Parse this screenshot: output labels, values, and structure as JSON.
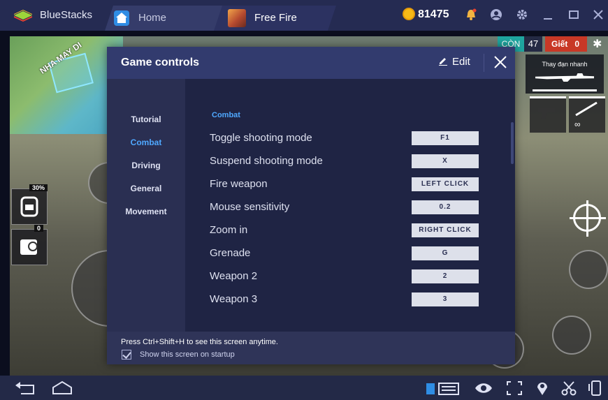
{
  "titlebar": {
    "app_name": "BlueStacks",
    "tabs": [
      {
        "label": "Home",
        "icon": "home-icon"
      },
      {
        "label": "Free Fire",
        "icon": "free-fire-app-icon"
      }
    ],
    "coins": "81475",
    "icons": [
      "notification-bell-icon",
      "account-icon",
      "settings-gear-icon",
      "minimize-icon",
      "maximize-icon",
      "close-icon"
    ]
  },
  "game_hud": {
    "map_label": "NHA MAY DI",
    "con_label": "CÒN",
    "alive_count": "47",
    "kill_label": "Giết",
    "kill_count": "0",
    "weapon_label": "Thay đạn nhanh",
    "backpack_percent": "30%",
    "item_count": "0",
    "ammo_symbol": "∞"
  },
  "dialog": {
    "title": "Game controls",
    "edit_label": "Edit",
    "nav": [
      "Tutorial",
      "Combat",
      "Driving",
      "General",
      "Movement"
    ],
    "active_nav": "Combat",
    "section_title": "Combat",
    "controls": [
      {
        "label": "Toggle shooting mode",
        "key": "F1"
      },
      {
        "label": "Suspend shooting mode",
        "key": "X"
      },
      {
        "label": "Fire weapon",
        "key": "LEFT CLICK"
      },
      {
        "label": "Mouse sensitivity",
        "key": "0.2"
      },
      {
        "label": "Zoom in",
        "key": "RIGHT CLICK"
      },
      {
        "label": "Grenade",
        "key": "G"
      },
      {
        "label": "Weapon 2",
        "key": "2"
      },
      {
        "label": "Weapon 3",
        "key": "3"
      }
    ],
    "footer_hint": "Press Ctrl+Shift+H to see this screen anytime.",
    "show_on_startup_label": "Show this screen on startup",
    "show_on_startup_checked": true
  },
  "bottombar": {
    "icons": [
      "back-icon",
      "home-outline-icon",
      "keyboard-icon",
      "eye-icon",
      "fullscreen-icon",
      "location-icon",
      "scissors-icon",
      "rotate-device-icon"
    ]
  },
  "colors": {
    "titlebar_bg": "#252b52",
    "dialog_header": "#323b6e",
    "dialog_content": "#1f2444",
    "accent_blue": "#4fa8ff",
    "coin_gold": "#f6b917"
  }
}
